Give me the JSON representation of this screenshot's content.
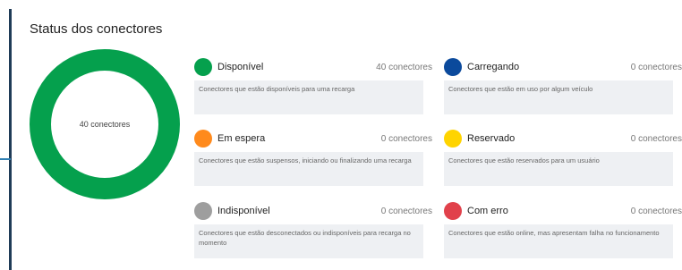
{
  "title": "Status dos conectores",
  "donut": {
    "label": "40 conectores",
    "color": "#05a04d"
  },
  "cards": [
    {
      "name": "Disponível",
      "count": "40 conectores",
      "description": "Conectores que estão disponíveis para uma recarga",
      "color": "#05a04d"
    },
    {
      "name": "Carregando",
      "count": "0 conectores",
      "description": "Conectores que estão em uso por algum veículo",
      "color": "#0b4a9c"
    },
    {
      "name": "Em espera",
      "count": "0 conectores",
      "description": "Conectores que estão suspensos, iniciando ou finalizando uma recarga",
      "color": "#ff8a1c"
    },
    {
      "name": "Reservado",
      "count": "0 conectores",
      "description": "Conectores que estão reservados para um usuário",
      "color": "#ffd400"
    },
    {
      "name": "Indisponível",
      "count": "0 conectores",
      "description": "Conectores que estão desconectados ou indisponíveis para recarga no momento",
      "color": "#9e9e9e"
    },
    {
      "name": "Com erro",
      "count": "0 conectores",
      "description": "Conectores que estão online, mas apresentam falha no funcionamento",
      "color": "#e1414b"
    }
  ]
}
